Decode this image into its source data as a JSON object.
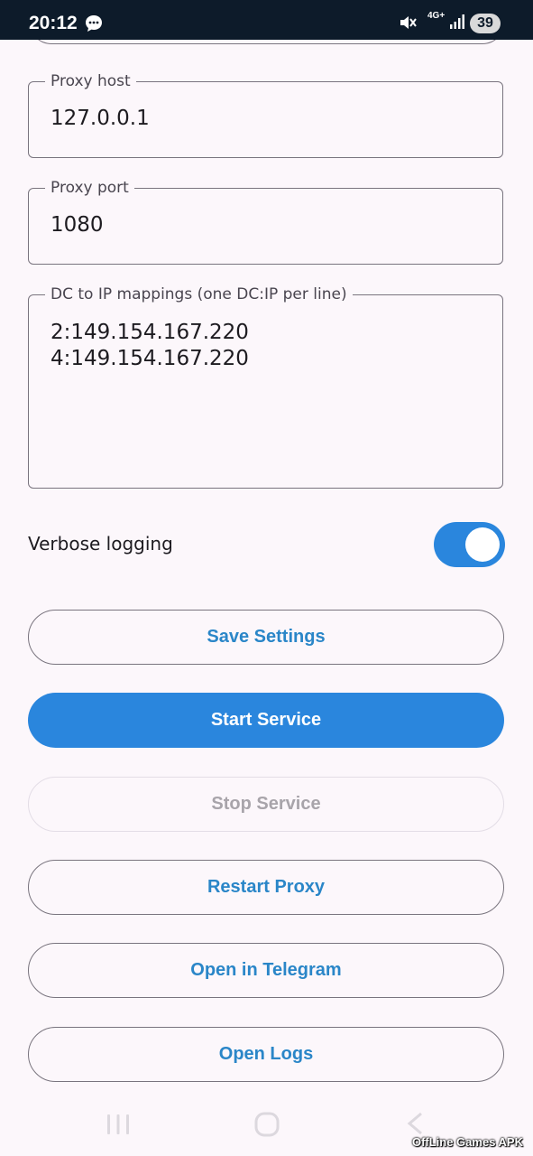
{
  "status_bar": {
    "time": "20:12",
    "network": "4G+",
    "battery": "39",
    "icons": [
      "chat-bubble-icon",
      "mute-icon",
      "signal-icon",
      "battery-icon"
    ]
  },
  "fields": {
    "proxy_host": {
      "label": "Proxy host",
      "value": "127.0.0.1"
    },
    "proxy_port": {
      "label": "Proxy port",
      "value": "1080"
    },
    "dc_mappings": {
      "label": "DC to IP mappings (one DC:IP per line)",
      "value": "2:149.154.167.220\n4:149.154.167.220"
    }
  },
  "verbose": {
    "label": "Verbose logging",
    "enabled": true
  },
  "buttons": {
    "save": "Save Settings",
    "start": "Start Service",
    "stop": "Stop Service",
    "restart": "Restart Proxy",
    "telegram": "Open in Telegram",
    "logs": "Open Logs"
  },
  "navigation": {
    "icons": [
      "recent-apps-icon",
      "home-icon",
      "back-icon"
    ]
  },
  "watermark": "OffLine Games APK",
  "colors": {
    "accent": "#2a86dd",
    "background": "#fcf7fb",
    "outline": "#79747e",
    "status_bar": "#0d1b2a"
  }
}
